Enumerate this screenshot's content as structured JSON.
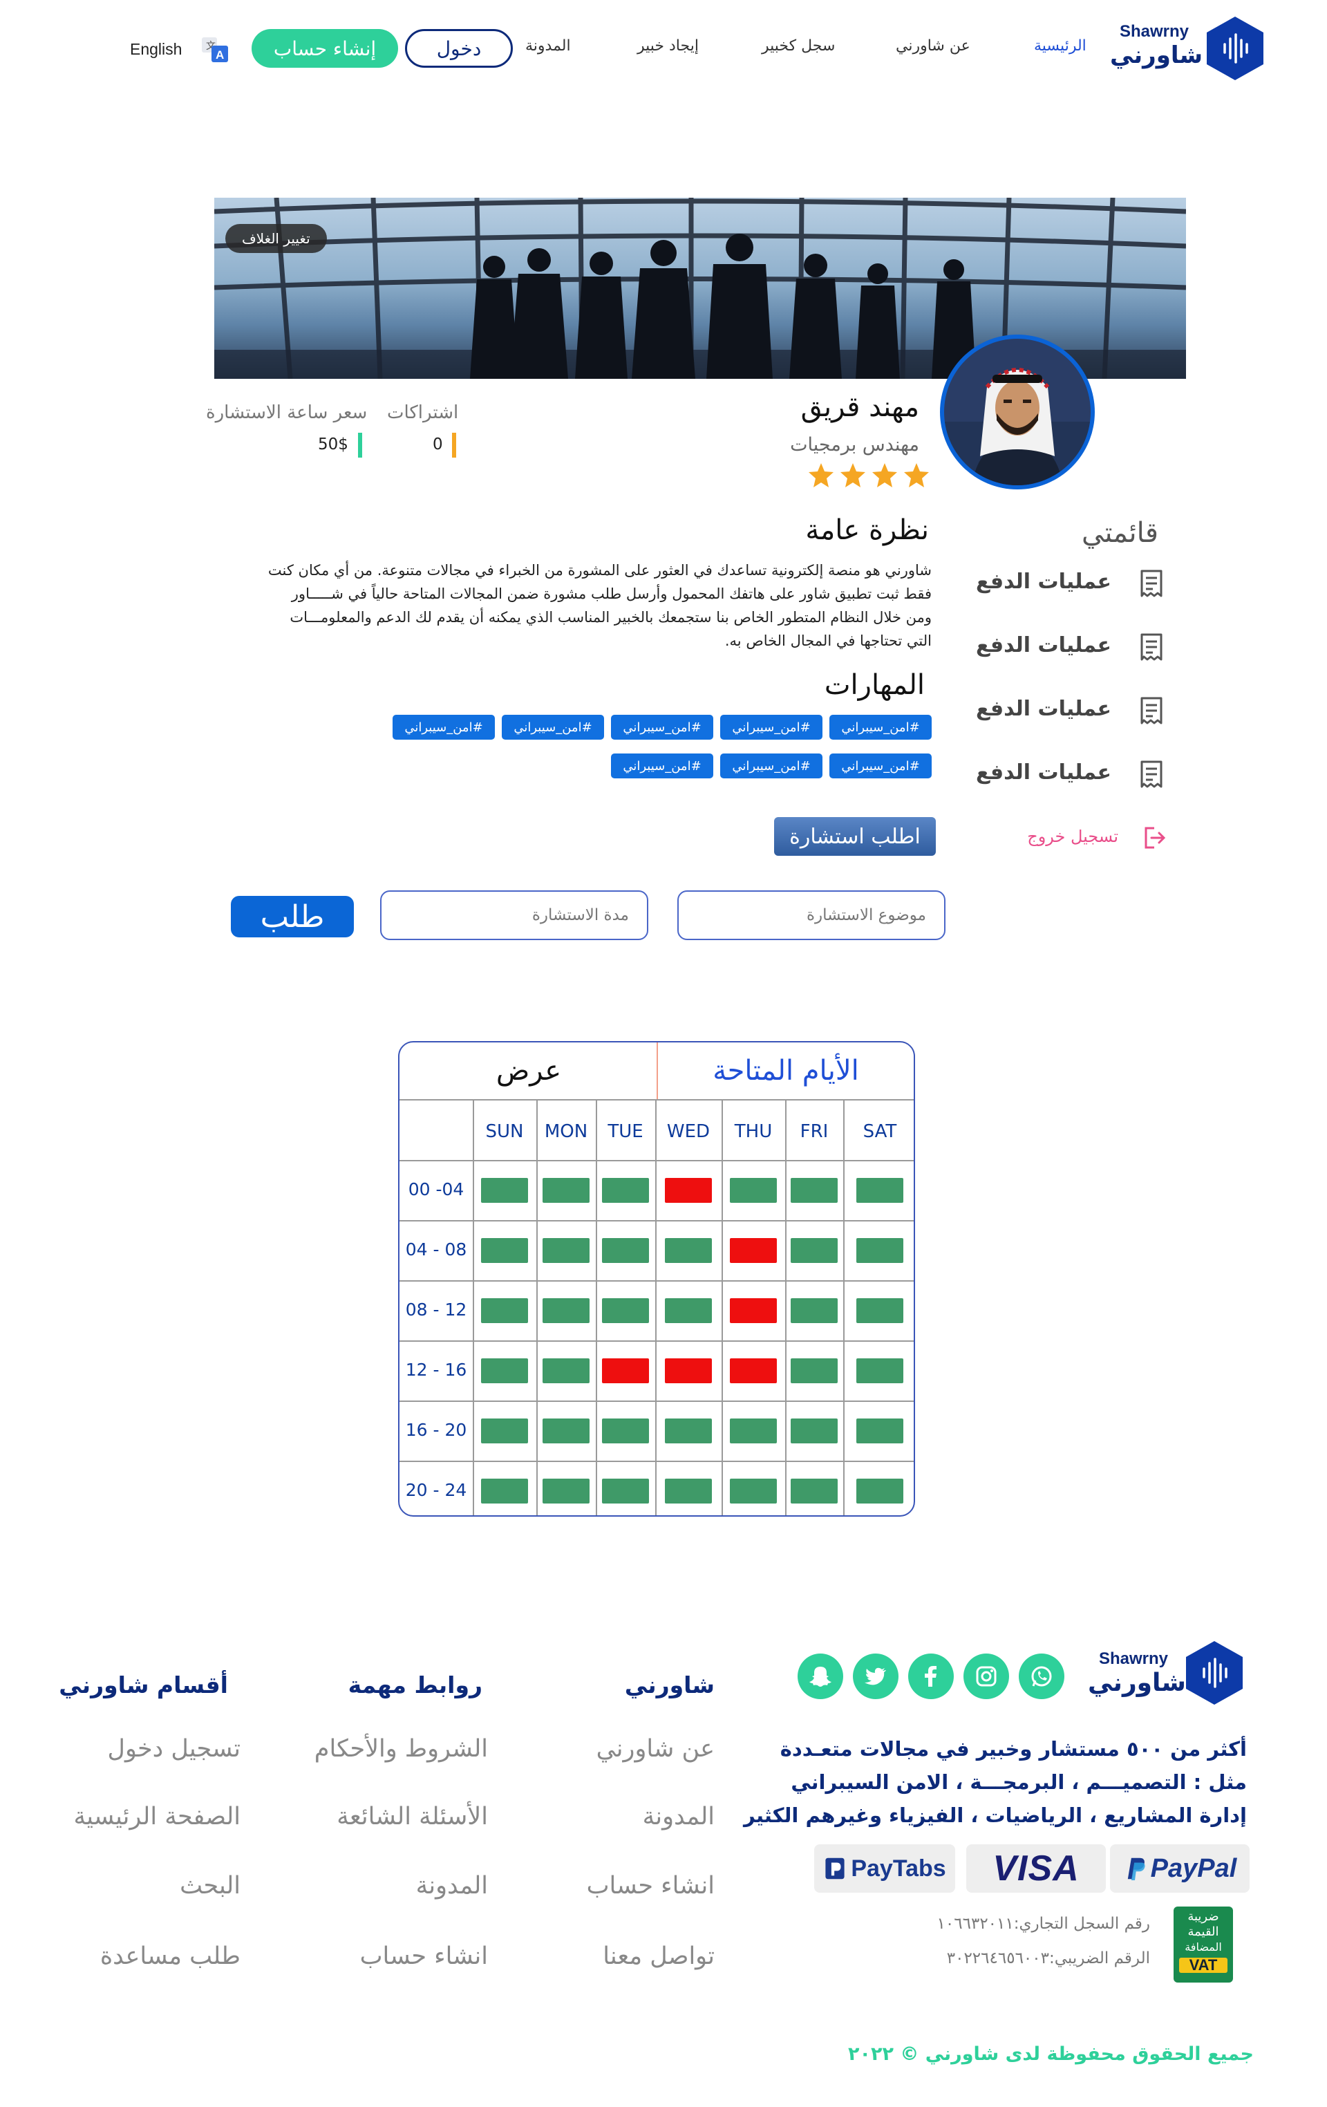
{
  "header": {
    "brand_en": "Shawrny",
    "brand_ar": "شاورني",
    "nav": [
      "الرئيسية",
      "عن شاورني",
      "سجل  كخبير",
      "إيجاد خبير",
      "المدونة"
    ],
    "login_label": "دخول",
    "signup_label": "إنشاء حساب",
    "language_label": "English",
    "language_icon": "translate-icon"
  },
  "cover": {
    "change_cover_label": "تغيير الغلاف"
  },
  "profile": {
    "name": "مهند قريق",
    "title": "مهندس برمجيات",
    "rating": 4,
    "rating_max": 4,
    "subscriptions_label": "اشتراكات",
    "subscriptions_value": "0",
    "hour_price_label": "سعر ساعة الاستشارة",
    "hour_price_value": "50$"
  },
  "sidebar": {
    "title": "قائمتي",
    "items": [
      {
        "label": "عمليات الدفع",
        "icon": "receipt-icon"
      },
      {
        "label": "عمليات الدفع",
        "icon": "receipt-icon"
      },
      {
        "label": "عمليات الدفع",
        "icon": "receipt-icon"
      },
      {
        "label": "عمليات الدفع",
        "icon": "receipt-icon"
      }
    ],
    "logout_label": "تسجيل خروج",
    "logout_icon": "logout-icon"
  },
  "overview": {
    "title": "نظرة عامة",
    "text": "شاورني هو منصة إلكترونية تساعدك في العثور على المشورة من الخبراء في مجالات متنوعة. من أي مكان كنت فقط ثبت تطبيق شاور على هاتفك المحمول وأرسل طلب مشورة ضمن المجالات المتاحة حالياً في شـــــاور ومن خلال النظام المتطور الخاص بنا ستجمعك بالخبير المناسب الذي يمكنه أن يقدم لك الدعم والمعلومـــات التي تحتاجها في المجال الخاص به."
  },
  "skills": {
    "title": "المهارات",
    "tags": [
      "#امن_سيبراني",
      "#امن_سيبراني",
      "#امن_سيبراني",
      "#امن_سيبراني",
      "#امن_سيبراني",
      "#امن_سيبراني",
      "#امن_سيبراني",
      "#امن_سيبراني"
    ]
  },
  "request_button_label": "اطلب استشارة",
  "consult_form": {
    "topic_placeholder": "موضوع الاستشارة",
    "duration_placeholder": "مدة الاستشارة",
    "submit_label": "طلب"
  },
  "schedule": {
    "tab_available": "الأيام المتاحة",
    "tab_view": "عرض",
    "days": [
      "SUN",
      "MON",
      "TUE",
      "WED",
      "THU",
      "FRI",
      "SAT"
    ],
    "slots": [
      "00 -04",
      "04 - 08",
      "08 - 12",
      "12 - 16",
      "16 - 20",
      "20 - 24"
    ],
    "status": [
      [
        "available",
        "available",
        "available",
        "booked",
        "available",
        "available",
        "available"
      ],
      [
        "available",
        "available",
        "available",
        "available",
        "booked",
        "available",
        "available"
      ],
      [
        "available",
        "available",
        "available",
        "available",
        "booked",
        "available",
        "available"
      ],
      [
        "available",
        "available",
        "booked",
        "booked",
        "booked",
        "available",
        "available"
      ],
      [
        "available",
        "available",
        "available",
        "available",
        "available",
        "available",
        "available"
      ],
      [
        "available",
        "available",
        "available",
        "available",
        "available",
        "available",
        "available"
      ]
    ],
    "colors": {
      "available": "#3f9a68",
      "booked": "#ee0f0f"
    }
  },
  "footer": {
    "brand_en": "Shawrny",
    "brand_ar": "شاورني",
    "social_icons": [
      "whatsapp-icon",
      "instagram-icon",
      "facebook-icon",
      "twitter-icon",
      "snapchat-icon"
    ],
    "about_lines": [
      "أكثر من ٥٠٠ مستشار وخبير في مجالات متعـددة",
      "مثل : التصميـــم ، البرمجـــة  ، الامن السيبراني",
      "إدارة المشاريع ، الرياضيات ، الفيزياء وغيرهم الكثير"
    ],
    "payments": [
      "PayPal",
      "VISA",
      "PayTabs"
    ],
    "vat_badge_lines": [
      "ضريبة",
      "القيمة",
      "المضافة",
      "VAT"
    ],
    "commercial_register": "رقم السجل التجاري:١٠٦٦٣٢٠١١",
    "tax_number": "الرقم الضريبي:٣٠٢٢٦٤٦٥٦٠٠٣",
    "copyright": "جميع الحقوق محفوظة لدى شاورني © ٢٠٢٢",
    "columns": [
      {
        "title": "شاورني",
        "links": [
          "عن شاورني",
          "المدونة",
          "انشاء حساب",
          "تواصل معنا"
        ]
      },
      {
        "title": "روابط مهمة",
        "links": [
          "الشروط والأحكام",
          "الأسئلة الشائعة",
          "المدونة",
          "انشاء حساب"
        ]
      },
      {
        "title": "أقسام شاورني",
        "links": [
          "تسجيل دخول",
          "الصفحة الرئيسية",
          "البحث",
          "طلب مساعدة"
        ]
      }
    ]
  }
}
